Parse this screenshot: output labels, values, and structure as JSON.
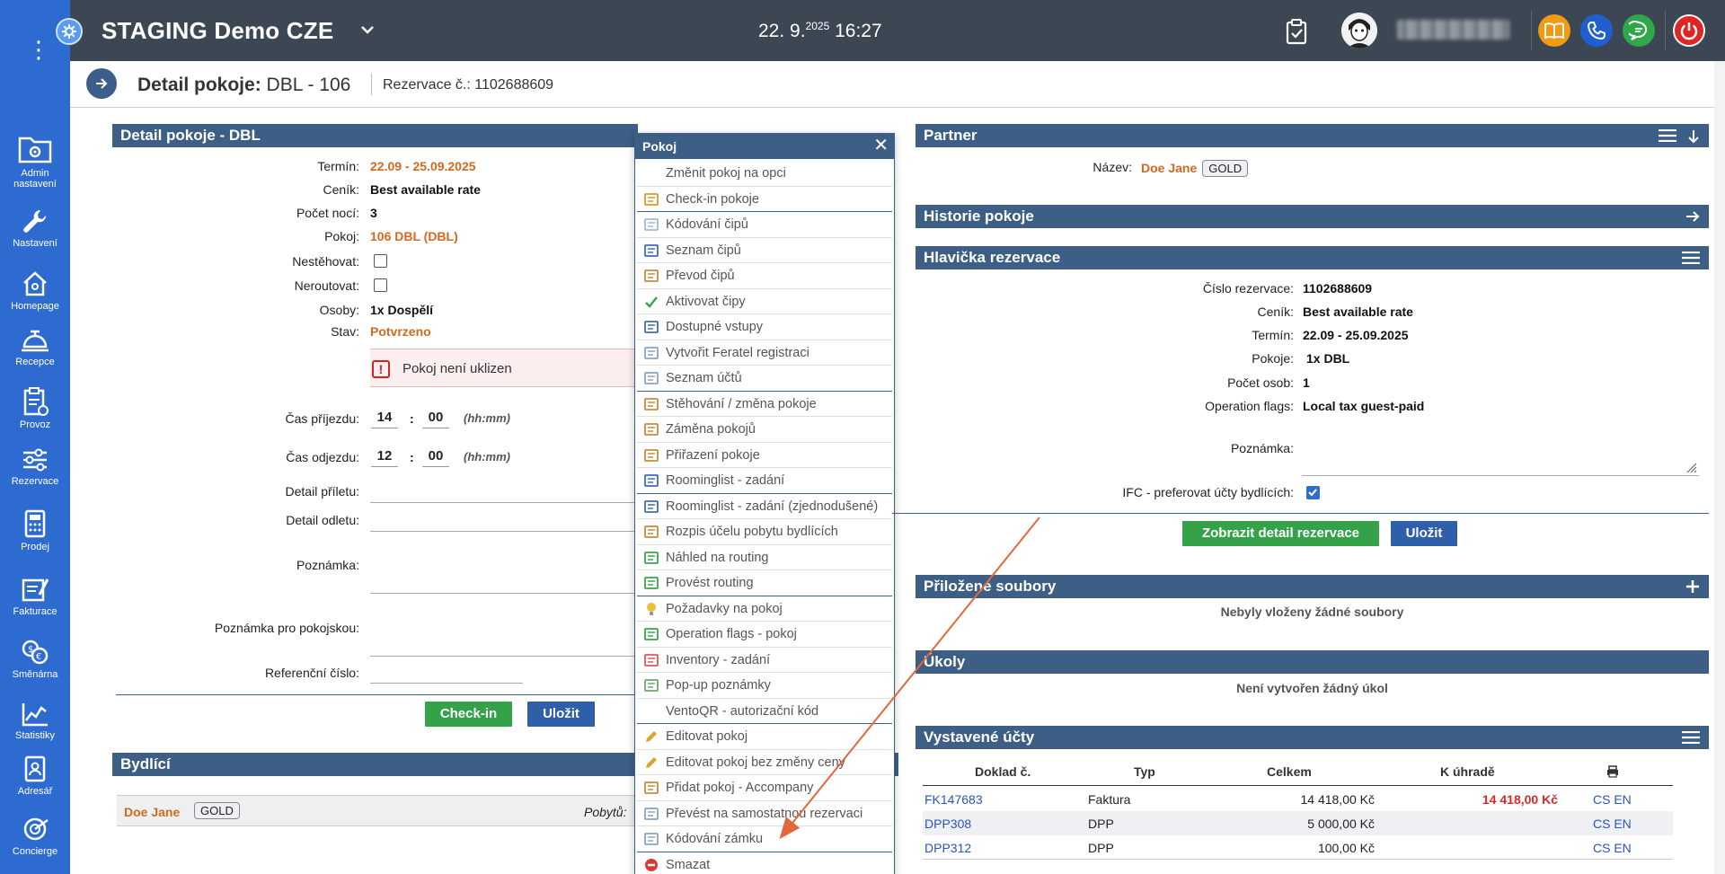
{
  "topbar": {
    "app_title": "STAGING Demo CZE",
    "date": "22. 9.",
    "year": "2025",
    "time": "16:27"
  },
  "sidebar": {
    "items": [
      {
        "label_1": "Admin",
        "label_2": "nastavení",
        "icon": "folder-gear-icon"
      },
      {
        "label_1": "Nastavení",
        "icon": "wrench-icon"
      },
      {
        "label_1": "Homepage",
        "icon": "home-icon"
      },
      {
        "label_1": "Recepce",
        "icon": "bell-icon"
      },
      {
        "label_1": "Provoz",
        "icon": "clipboard-icon"
      },
      {
        "label_1": "Rezervace",
        "icon": "sliders-icon"
      },
      {
        "label_1": "Prodej",
        "icon": "calculator-icon"
      },
      {
        "label_1": "Fakturace",
        "icon": "invoice-icon"
      },
      {
        "label_1": "Směnárna",
        "icon": "coins-icon"
      },
      {
        "label_1": "Statistiky",
        "icon": "chart-icon"
      },
      {
        "label_1": "Adresář",
        "icon": "address-book-icon"
      },
      {
        "label_1": "Concierge",
        "icon": "concierge-icon"
      }
    ]
  },
  "header": {
    "title_bold": "Detail pokoje:",
    "title_rest": "DBL - 106",
    "reservation": "Rezervace č.: 1102688609"
  },
  "room_detail": {
    "panel_title": "Detail pokoje - DBL",
    "fields": {
      "termin_label": "Termín:",
      "termin_value": "22.09 - 25.09.2025",
      "cenik_label": "Ceník:",
      "cenik_value": "Best available rate",
      "noci_label": "Počet nocí:",
      "noci_value": "3",
      "pokoj_label": "Pokoj:",
      "pokoj_value": "106 DBL (DBL)",
      "nestehovat_label": "Nestěhovat:",
      "neroutovat_label": "Neroutovat:",
      "osoby_label": "Osoby:",
      "osoby_value": "1x Dospělí",
      "stav_label": "Stav:",
      "stav_value": "Potvrzeno"
    },
    "alert": "Pokoj není uklizen",
    "arrival_label": "Čas příjezdu:",
    "arrival_h": "14",
    "arrival_m": "00",
    "departure_label": "Čas odjezdu:",
    "departure_h": "12",
    "departure_m": "00",
    "hhmm": "(hh:mm)",
    "colon": ":",
    "flight_in_label": "Detail příletu:",
    "flight_out_label": "Detail odletu:",
    "note_label": "Poznámka:",
    "housekeeping_note_label": "Poznámka pro pokojskou:",
    "reference_label": "Referenční číslo:",
    "checkin_button": "Check-in",
    "save_button": "Uložit"
  },
  "residents": {
    "panel_title": "Bydlící",
    "name": "Doe Jane",
    "badge": "GOLD",
    "stays_label": "Pobytů:"
  },
  "popup": {
    "title": "Pokoj",
    "close": "✕",
    "items": [
      "Změnit pokoj na opci",
      "Check-in pokoje",
      "Kódování čipů",
      "Seznam čipů",
      "Převod čipů",
      "Aktivovat čipy",
      "Dostupné vstupy",
      "Vytvořit Feratel registraci",
      "Seznam účtů",
      "Stěhování / změna pokoje",
      "Záměna pokojů",
      "Přiřazení pokoje",
      "Roominglist - zadání",
      "Roominglist - zadání (zjednodušené)",
      "Rozpis účelu pobytu bydlících",
      "Náhled na routing",
      "Provést routing",
      "Požadavky na pokoj",
      "Operation flags - pokoj",
      "Inventory - zadání",
      "Pop-up poznámky",
      "VentoQR - autorizační kód",
      "Editovat pokoj",
      "Editovat pokoj bez změny ceny",
      "Přidat pokoj - Accompany",
      "Převést na samostatnou rezervaci",
      "Kódování zámku",
      "Smazat"
    ]
  },
  "partner": {
    "panel_title": "Partner",
    "name_label": "Název:",
    "name_value": "Doe Jane",
    "badge": "GOLD"
  },
  "history": {
    "panel_title": "Historie pokoje"
  },
  "reservation_header": {
    "panel_title": "Hlavička rezervace",
    "cislo_label": "Číslo rezervace:",
    "cislo_value": "1102688609",
    "cenik_label": "Ceník:",
    "cenik_value": "Best available rate",
    "termin_label": "Termín:",
    "termin_value": "22.09 - 25.09.2025",
    "pokoje_label": "Pokoje:",
    "pokoje_value": "1x DBL",
    "osob_label": "Počet osob:",
    "osob_value": "1",
    "flags_label": "Operation flags:",
    "flags_value": "Local tax guest-paid",
    "note_label": "Poznámka:",
    "ifc_label": "IFC - preferovat účty bydlících:",
    "detail_button": "Zobrazit detail rezervace",
    "save_button": "Uložit"
  },
  "attachments": {
    "panel_title": "Přiložené soubory",
    "empty": "Nebyly vloženy žádné soubory"
  },
  "tasks": {
    "panel_title": "Úkoly",
    "empty": "Není vytvořen žádný úkol"
  },
  "accounts": {
    "panel_title": "Vystavené účty",
    "headers": [
      "Doklad č.",
      "Typ",
      "Celkem",
      "K úhradě"
    ],
    "rows": [
      {
        "doc": "FK147683",
        "type": "Faktura",
        "total": "14 418,00 Kč",
        "due": "14 418,00 Kč",
        "lang": "CS EN"
      },
      {
        "doc": "DPP308",
        "type": "DPP",
        "total": "5 000,00 Kč",
        "due": "",
        "lang": "CS EN"
      },
      {
        "doc": "DPP312",
        "type": "DPP",
        "total": "100,00 Kč",
        "due": "",
        "lang": "CS EN"
      }
    ]
  },
  "colors": {
    "topbar": "#3d4754",
    "sidebar": "#2e6bd1",
    "panel": "#3d5f86",
    "accent_orange": "#d2691e",
    "green": "#35a24a",
    "annotation_arrow": "#e0683a"
  }
}
